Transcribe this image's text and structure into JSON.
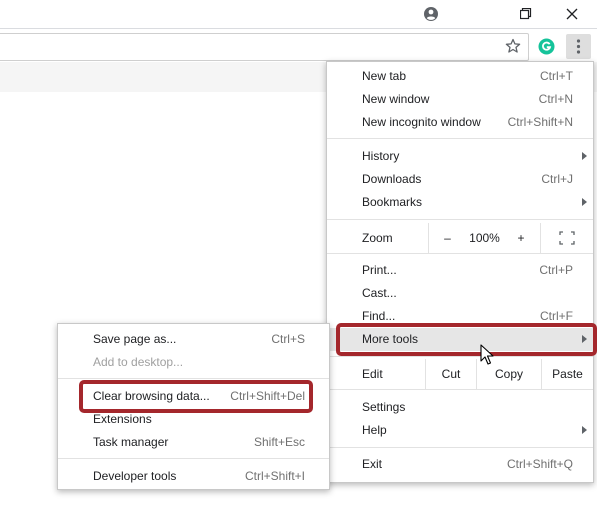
{
  "window_controls": {
    "profile_icon": "account-circle-icon",
    "restore_icon": "restore-icon",
    "close_icon": "close-icon"
  },
  "toolbar": {
    "bookmark_icon": "star-icon",
    "extension_icon": "grammarly-icon",
    "extension_color": "#15c39a",
    "menu_icon": "kebab-menu-icon"
  },
  "menu": {
    "new_tab": {
      "label": "New tab",
      "shortcut": "Ctrl+T"
    },
    "new_window": {
      "label": "New window",
      "shortcut": "Ctrl+N"
    },
    "new_incognito": {
      "label": "New incognito window",
      "shortcut": "Ctrl+Shift+N"
    },
    "history": {
      "label": "History"
    },
    "downloads": {
      "label": "Downloads",
      "shortcut": "Ctrl+J"
    },
    "bookmarks": {
      "label": "Bookmarks"
    },
    "zoom": {
      "label": "Zoom",
      "minus": "–",
      "value": "100%",
      "plus": "+"
    },
    "print": {
      "label": "Print...",
      "shortcut": "Ctrl+P"
    },
    "cast": {
      "label": "Cast..."
    },
    "find": {
      "label": "Find...",
      "shortcut": "Ctrl+F"
    },
    "more_tools": {
      "label": "More tools"
    },
    "edit": {
      "label": "Edit",
      "cut": "Cut",
      "copy": "Copy",
      "paste": "Paste"
    },
    "settings": {
      "label": "Settings"
    },
    "help": {
      "label": "Help"
    },
    "exit": {
      "label": "Exit",
      "shortcut": "Ctrl+Shift+Q"
    }
  },
  "submenu": {
    "save_page": {
      "label": "Save page as...",
      "shortcut": "Ctrl+S"
    },
    "add_desktop": {
      "label": "Add to desktop..."
    },
    "clear_browsing": {
      "label": "Clear browsing data...",
      "shortcut": "Ctrl+Shift+Del"
    },
    "extensions": {
      "label": "Extensions"
    },
    "task_manager": {
      "label": "Task manager",
      "shortcut": "Shift+Esc"
    },
    "developer_tools": {
      "label": "Developer tools",
      "shortcut": "Ctrl+Shift+I"
    }
  },
  "highlight_color": "#a4272c"
}
